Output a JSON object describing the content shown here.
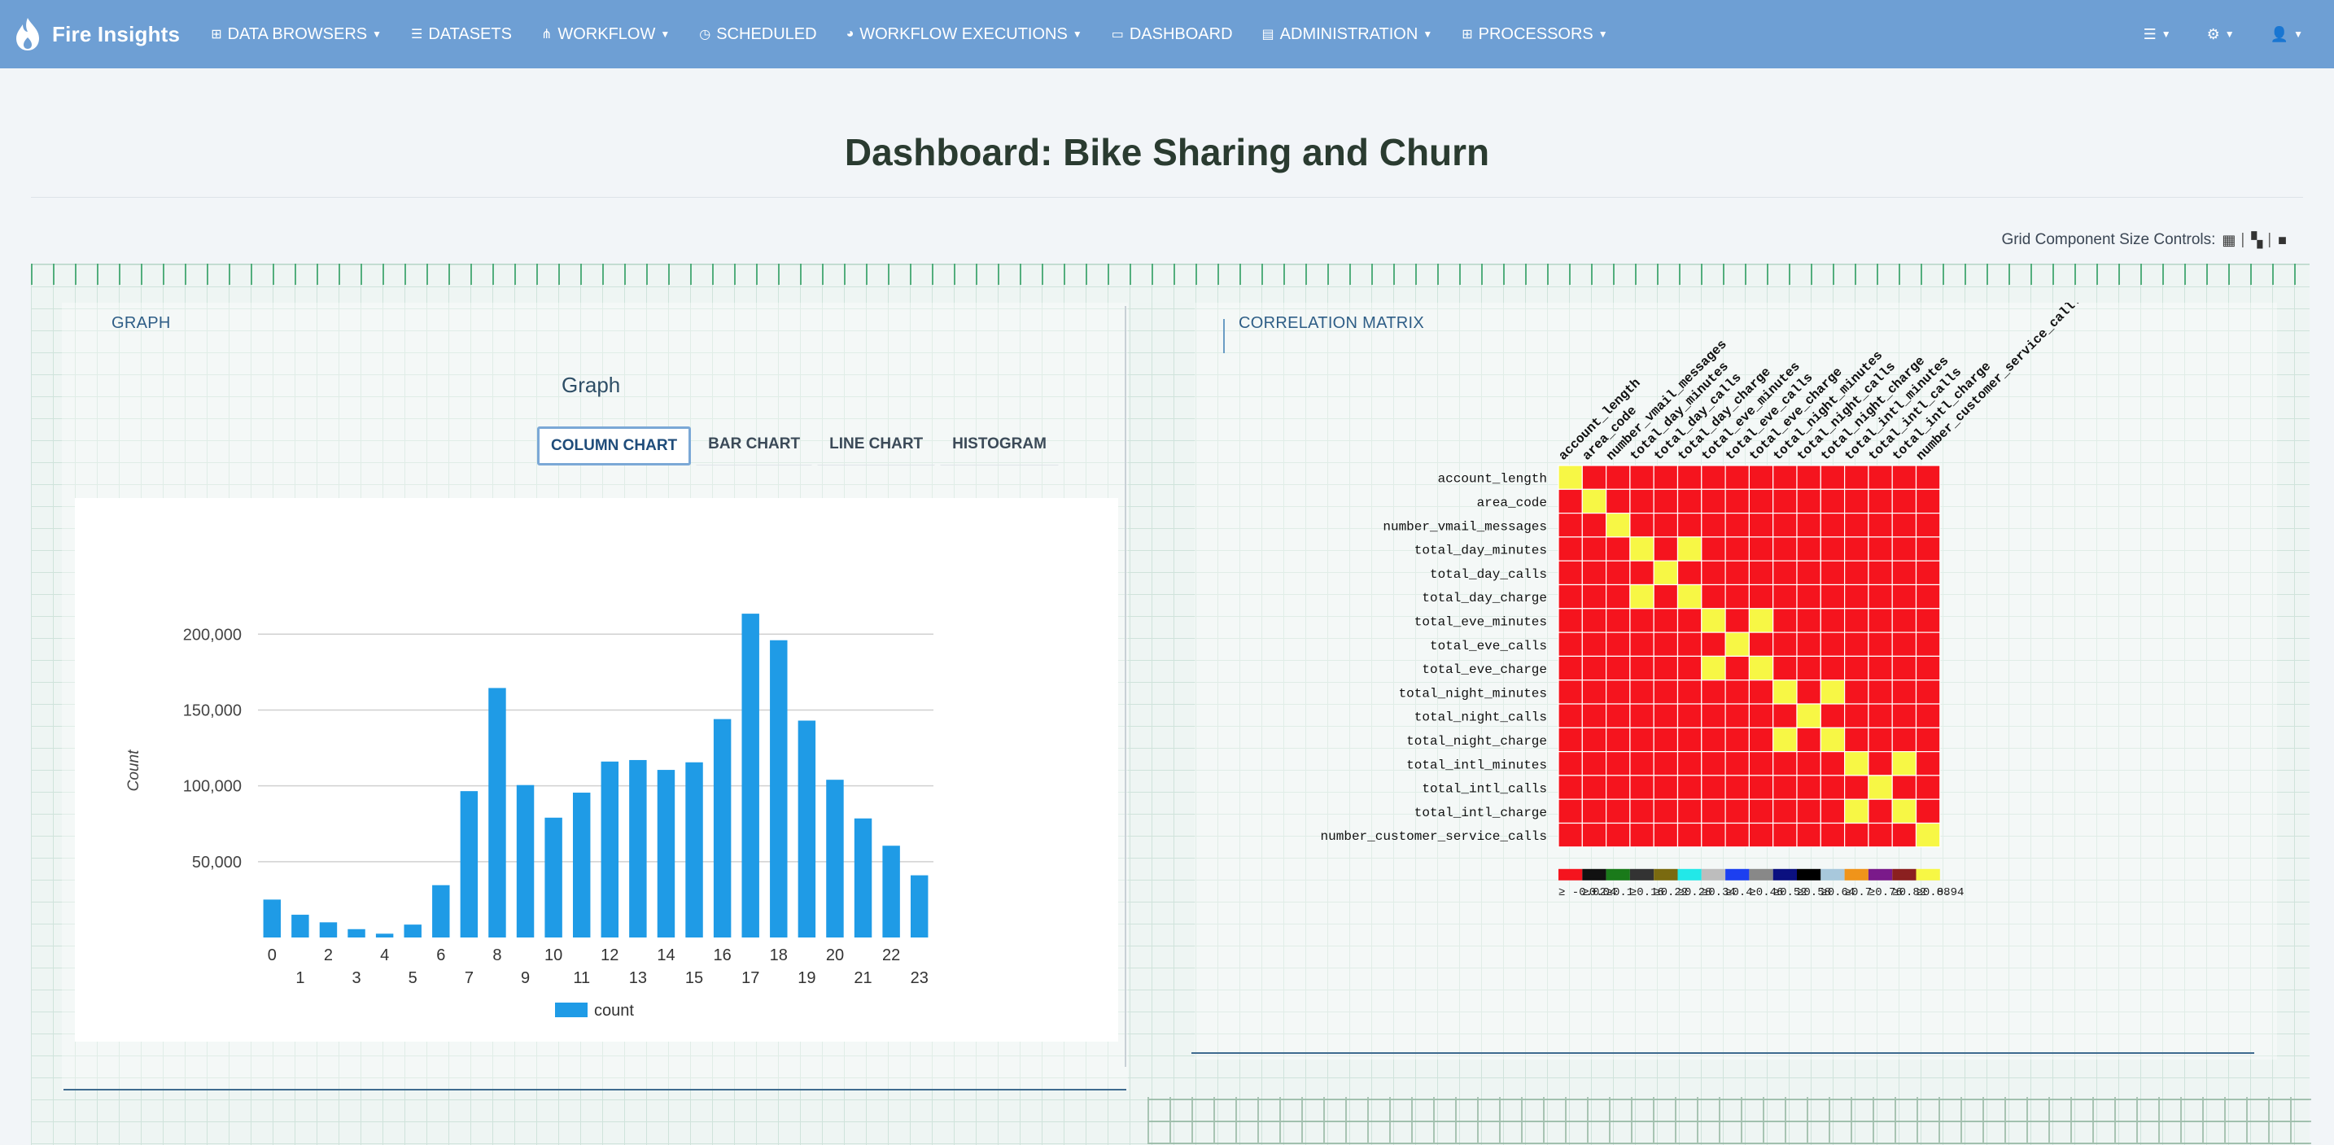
{
  "nav": {
    "brand": "Fire Insights",
    "items": [
      {
        "label": "DATA BROWSERS",
        "icon": "database-icon",
        "glyph": "⊞",
        "caret": true
      },
      {
        "label": "DATASETS",
        "icon": "table-icon",
        "glyph": "☰",
        "caret": false
      },
      {
        "label": "WORKFLOW",
        "icon": "sitemap-icon",
        "glyph": "⋔",
        "caret": true
      },
      {
        "label": "SCHEDULED",
        "icon": "clock-icon",
        "glyph": "◷",
        "caret": false
      },
      {
        "label": "WORKFLOW EXECUTIONS",
        "icon": "pie-chart-icon",
        "glyph": "◕",
        "caret": true
      },
      {
        "label": "DASHBOARD",
        "icon": "monitor-icon",
        "glyph": "▭",
        "caret": false
      },
      {
        "label": "ADMINISTRATION",
        "icon": "clipboard-icon",
        "glyph": "▤",
        "caret": true
      },
      {
        "label": "PROCESSORS",
        "icon": "grid-icon",
        "glyph": "⊞",
        "caret": true
      }
    ],
    "right": [
      {
        "icon": "list-icon",
        "glyph": "☰"
      },
      {
        "icon": "gears-icon",
        "glyph": "⚙"
      },
      {
        "icon": "user-icon",
        "glyph": "👤"
      }
    ]
  },
  "page": {
    "title": "Dashboard: Bike Sharing and Churn",
    "size_controls_label": "Grid Component Size Controls:"
  },
  "left_panel": {
    "label": "GRAPH",
    "graph_title": "Graph",
    "tabs": [
      {
        "label": "COLUMN CHART",
        "active": true
      },
      {
        "label": "BAR CHART",
        "active": false
      },
      {
        "label": "LINE CHART",
        "active": false
      },
      {
        "label": "HISTOGRAM",
        "active": false
      }
    ]
  },
  "right_panel": {
    "label": "CORRELATION MATRIX"
  },
  "chart_data": [
    {
      "type": "bar",
      "title": "",
      "xlabel": "",
      "ylabel": "Count",
      "categories": [
        "0",
        "1",
        "2",
        "3",
        "4",
        "5",
        "6",
        "7",
        "8",
        "9",
        "10",
        "11",
        "12",
        "13",
        "14",
        "15",
        "16",
        "17",
        "18",
        "19",
        "20",
        "21",
        "22",
        "23"
      ],
      "series": [
        {
          "name": "count",
          "color": "#1f9be6",
          "values": [
            25000,
            15000,
            10000,
            5500,
            2500,
            8500,
            34500,
            96500,
            164500,
            100500,
            79000,
            95500,
            116000,
            117000,
            110500,
            115500,
            144000,
            213500,
            196000,
            143000,
            104000,
            78500,
            60500,
            41000
          ]
        }
      ],
      "yticks": [
        50000,
        100000,
        150000,
        200000
      ],
      "ytick_labels": [
        "50,000",
        "100,000",
        "150,000",
        "200,000"
      ],
      "ylim": [
        0,
        220000
      ],
      "grid": true,
      "legend": "bottom"
    },
    {
      "type": "heatmap",
      "title": "",
      "labels": [
        "account_length",
        "area_code",
        "number_vmail_messages",
        "total_day_minutes",
        "total_day_calls",
        "total_day_charge",
        "total_eve_minutes",
        "total_eve_calls",
        "total_eve_charge",
        "total_night_minutes",
        "total_night_calls",
        "total_night_charge",
        "total_intl_minutes",
        "total_intl_calls",
        "total_intl_charge",
        "number_customer_service_calls"
      ],
      "column_labels": [
        "account_length",
        "area_code",
        "number_vmail_messages",
        "total_day_minutes",
        "total_day_calls",
        "total_day_charge",
        "total_eve_minutes",
        "total_eve_calls",
        "total_eve_charge",
        "total_night_minutes",
        "total_night_calls",
        "total_night_charge",
        "total_intl_minutes",
        "total_intl_calls",
        "total_intl_charge",
        "number_customer_service_call."
      ],
      "high_cells": [
        [
          0,
          0
        ],
        [
          1,
          1
        ],
        [
          2,
          2
        ],
        [
          3,
          3
        ],
        [
          3,
          5
        ],
        [
          4,
          4
        ],
        [
          5,
          3
        ],
        [
          5,
          5
        ],
        [
          6,
          6
        ],
        [
          6,
          8
        ],
        [
          7,
          7
        ],
        [
          8,
          6
        ],
        [
          8,
          8
        ],
        [
          9,
          9
        ],
        [
          9,
          11
        ],
        [
          10,
          10
        ],
        [
          11,
          9
        ],
        [
          11,
          11
        ],
        [
          12,
          12
        ],
        [
          12,
          14
        ],
        [
          13,
          13
        ],
        [
          14,
          12
        ],
        [
          14,
          14
        ],
        [
          15,
          15
        ]
      ],
      "low_color": "#f5141e",
      "high_color": "#f7f745",
      "legend_colors": [
        "#f5141e",
        "#111111",
        "#1a7a1a",
        "#333333",
        "#7a6a10",
        "#22e8e8",
        "#bdbdbd",
        "#1c3ff0",
        "#888888",
        "#0b1080",
        "#000000",
        "#a8c8dc",
        "#f0941a",
        "#7a1a8a",
        "#8b2020",
        "#f7f745"
      ],
      "legend_labels": [
        "≥ -0.02",
        "≥0.04",
        "≥0.1",
        "≥0.16",
        "≥0.22",
        "≥0.28",
        "≥0.34",
        "≥0.4",
        "≥0.46",
        "≥0.52",
        "≥0.58",
        "≥0.64",
        "≥0.7",
        "≥0.76",
        "≥0.82",
        "≥0.88"
      ],
      "legend_end_label": "0.94"
    }
  ]
}
